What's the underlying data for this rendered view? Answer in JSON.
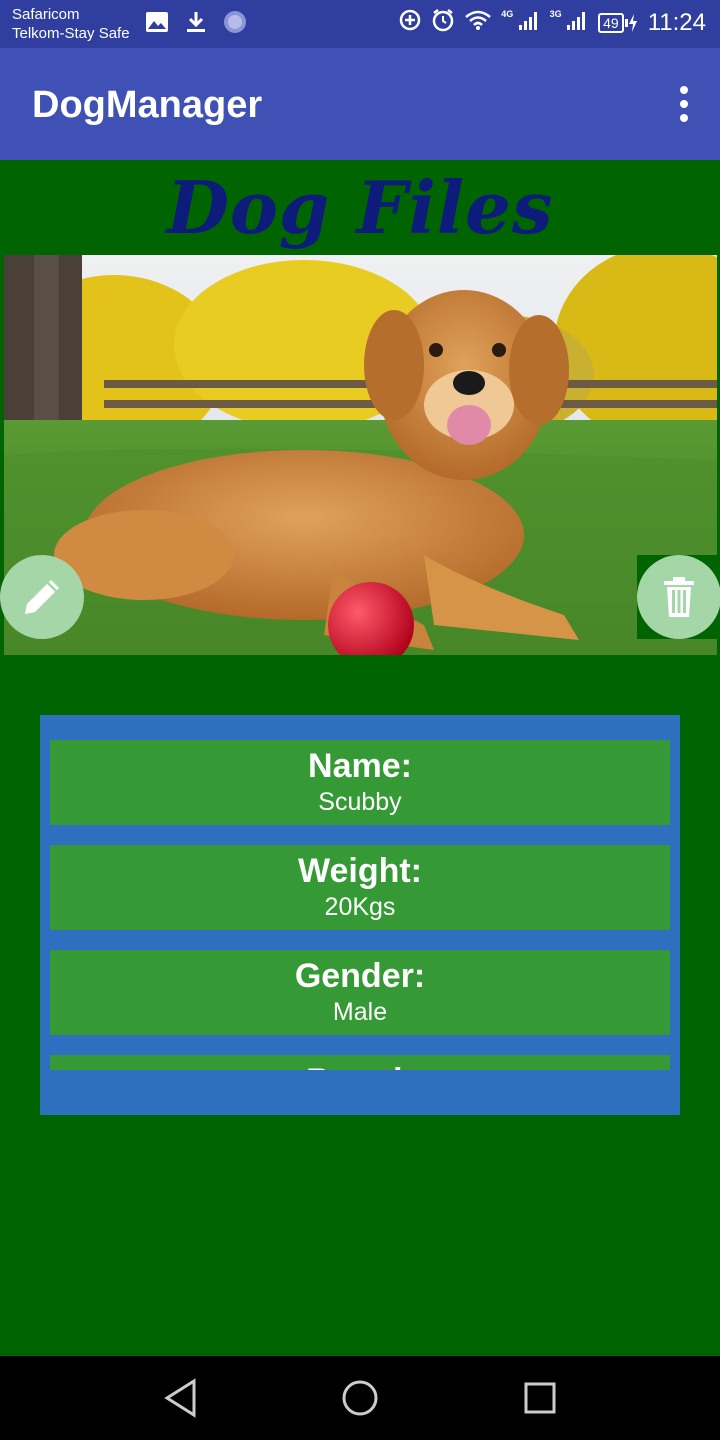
{
  "status_bar": {
    "carrier_1": "Safaricom",
    "carrier_2": "Telkom-Stay Safe",
    "network_1": "4G",
    "network_2": "3G",
    "battery": "49",
    "time": "11:24"
  },
  "app_bar": {
    "title": "DogManager"
  },
  "heading": "Dog Files",
  "info": [
    {
      "label": "Name:",
      "value": "Scubby"
    },
    {
      "label": "Weight:",
      "value": "20Kgs"
    },
    {
      "label": "Gender:",
      "value": "Male"
    },
    {
      "label": "Breed:",
      "value": ""
    }
  ],
  "colors": {
    "status_bar": "#303f9f",
    "app_bar": "#3f51b5",
    "background": "#006400",
    "heading": "#0d1b7a",
    "panel": "#2f6fc0",
    "card": "#359a35",
    "fab": "#a5d6a7"
  },
  "icons": {
    "edit": "pencil-icon",
    "delete": "trash-icon",
    "more": "more-vert-icon"
  }
}
